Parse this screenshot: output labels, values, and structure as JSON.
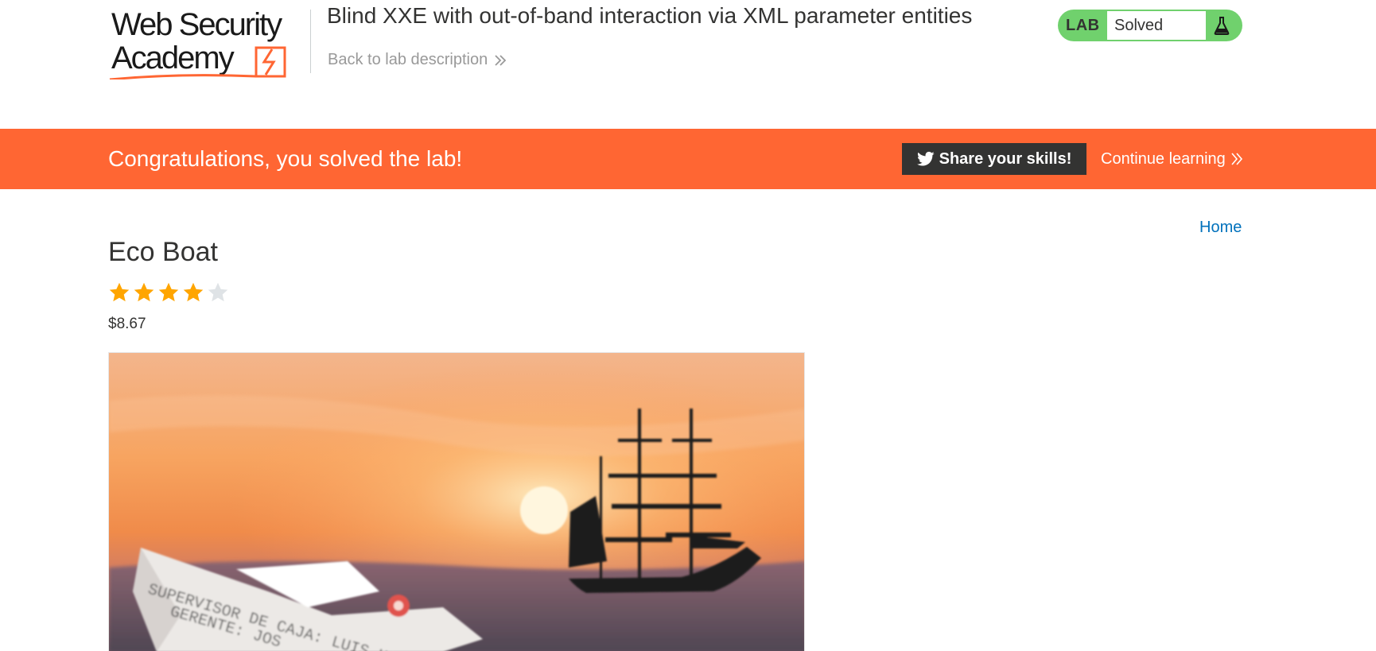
{
  "header": {
    "logo_line1": "Web Security",
    "logo_line2": "Academy",
    "lab_title": "Blind XXE with out-of-band interaction via XML parameter entities",
    "back_link": "Back to lab description",
    "status": {
      "badge": "LAB",
      "value": "Solved",
      "icon": "flask-icon",
      "color": "#70d16d"
    }
  },
  "banner": {
    "message": "Congratulations, you solved the lab!",
    "share_label": "Share your skills!",
    "share_icon": "twitter-icon",
    "continue_label": "Continue learning",
    "color": "#ff6633"
  },
  "nav": {
    "home": "Home"
  },
  "product": {
    "name": "Eco Boat",
    "rating": 4,
    "rating_max": 5,
    "price": "$8.67",
    "image_alt": "Paper boat and sailing ship at sunset",
    "image_text_line1": "SUPERVISOR DE CAJA: LUIS HARO",
    "image_text_line2": "GERENTE: JOS"
  },
  "colors": {
    "accent": "#ff6633",
    "link": "#0071bc",
    "star_on": "#ffa500",
    "star_off": "#dfe3e6"
  }
}
